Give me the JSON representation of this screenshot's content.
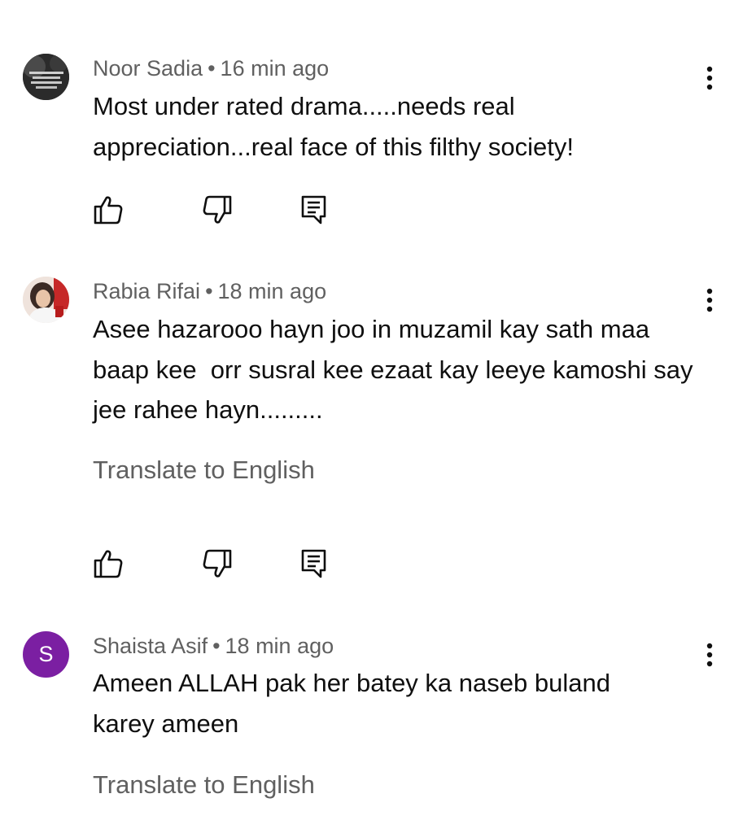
{
  "comments": [
    {
      "author": "Noor Sadia",
      "time": "16 min ago",
      "text": "Most under rated drama.....needs real appreciation...real face of this filthy society!",
      "avatar_type": "image",
      "avatar_text": "Stay Low, Go Fast\nKill First, Die Last\nOne Shot, One Kill\nNo Luck"
    },
    {
      "author": "Rabia Rifai",
      "time": "18 min ago",
      "text": "Asee hazarooo hayn joo in muzamil kay sath maa baap kee  orr susral kee ezaat kay leeye kamoshi say jee rahee hayn.........",
      "avatar_type": "image",
      "translate_label": "Translate to English"
    },
    {
      "author": "Shaista Asif",
      "time": "18 min ago",
      "text": "Ameen ALLAH pak her batey ka naseb buland karey ameen",
      "avatar_type": "letter",
      "avatar_letter": "S",
      "avatar_color": "#7b1fa2",
      "translate_label": "Translate to English"
    }
  ],
  "separator": "•",
  "icons": {
    "like": "thumb-up-icon",
    "dislike": "thumb-down-icon",
    "reply": "reply-icon",
    "menu": "more-vert-icon"
  }
}
